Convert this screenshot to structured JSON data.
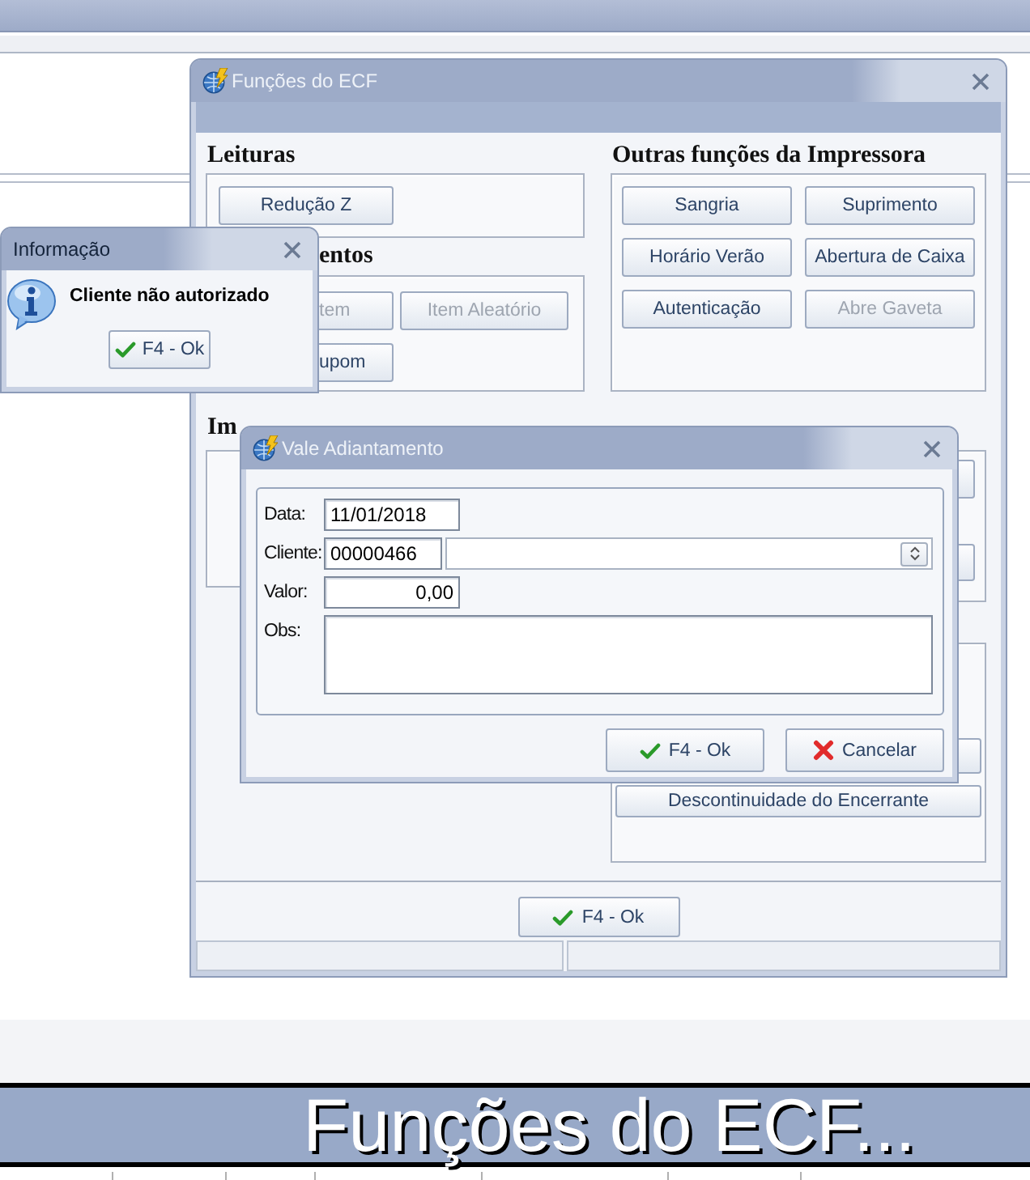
{
  "ecf_window": {
    "title": "Funções do ECF",
    "active": false,
    "leituras": {
      "heading": "Leituras",
      "buttons": [
        {
          "label": "Redução Z",
          "disabled": false
        }
      ]
    },
    "lancamentos": {
      "heading": "entos",
      "buttons": [
        {
          "kind": "partial",
          "label": "tem",
          "disabled": true
        },
        {
          "kind": "full",
          "label": "Item Aleatório",
          "disabled": true
        },
        {
          "kind": "partial",
          "label": "upom",
          "disabled": false
        }
      ]
    },
    "impressoes": {
      "heading": "Im"
    },
    "outras": {
      "heading": "Outras funções da Impressora",
      "buttons": [
        {
          "label": "Sangria",
          "disabled": false
        },
        {
          "label": "Suprimento",
          "disabled": false
        },
        {
          "label": "Horário Verão",
          "disabled": false
        },
        {
          "label": "Abertura de Caixa",
          "disabled": false
        },
        {
          "label": "Autenticação",
          "disabled": false
        },
        {
          "label": "Abre Gaveta",
          "disabled": true
        }
      ]
    },
    "encerrante_button": {
      "label": "Descontinuidade do Encerrante",
      "disabled": false
    },
    "ok_button": {
      "label": "F4 - Ok"
    }
  },
  "info_window": {
    "title": "Informação",
    "active": true,
    "message": "Cliente não autorizado",
    "button": {
      "label": "F4 - Ok"
    }
  },
  "vale_window": {
    "title": "Vale Adiantamento",
    "active": false,
    "fields": [
      {
        "kind": "text",
        "label": "Data:",
        "value": "11/01/2018"
      },
      {
        "kind": "lookup",
        "label": "Cliente:",
        "value": "00000466"
      },
      {
        "kind": "number",
        "label": "Valor:",
        "value": "0,00"
      },
      {
        "kind": "memo",
        "label": "Obs:"
      }
    ],
    "buttons": [
      {
        "kind": "ok",
        "label": "F4 - Ok"
      },
      {
        "kind": "cancel",
        "label": "Cancelar"
      }
    ]
  },
  "app": {
    "caption": "Funções do ECF..."
  }
}
